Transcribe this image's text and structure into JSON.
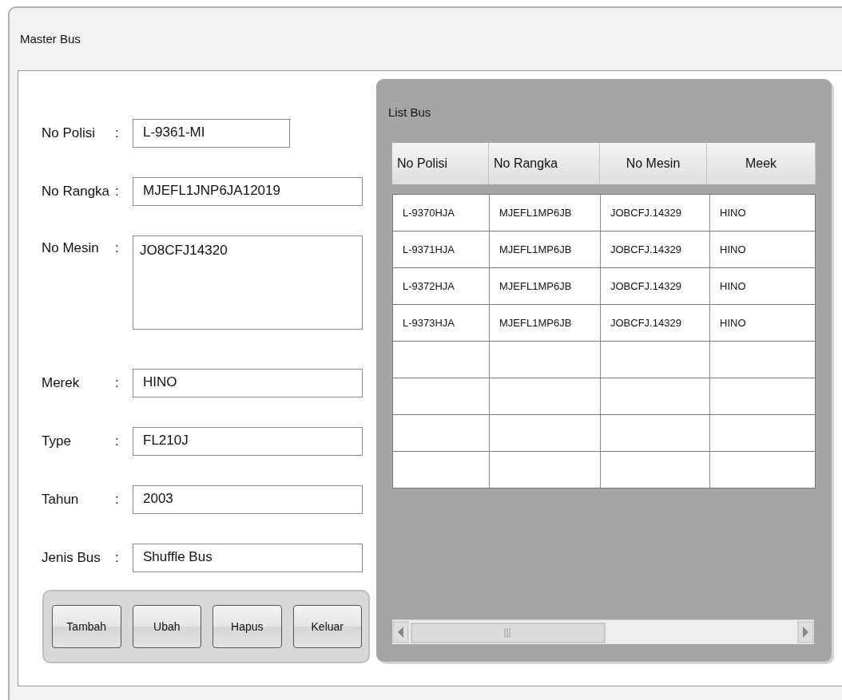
{
  "window": {
    "title": "Master Bus"
  },
  "form": {
    "fields": [
      {
        "label": "No Polisi",
        "separator": ":",
        "value": "L-9361-MI",
        "kind": "short"
      },
      {
        "label": "No Rangka",
        "separator": ":",
        "value": "MJEFL1JNP6JA12019",
        "kind": "text"
      },
      {
        "label": "No Mesin",
        "separator": ":",
        "value": "JO8CFJ14320",
        "kind": "textarea"
      },
      {
        "label": "Merek",
        "separator": ":",
        "value": "HINO",
        "kind": "text"
      },
      {
        "label": "Type",
        "separator": ":",
        "value": "FL210J",
        "kind": "text"
      },
      {
        "label": "Tahun",
        "separator": ":",
        "value": "2003",
        "kind": "text"
      },
      {
        "label": "Jenis Bus",
        "separator": ":",
        "value": "Shuffle Bus",
        "kind": "text"
      }
    ],
    "buttons": [
      "Tambah",
      "Ubah",
      "Hapus",
      "Keluar"
    ]
  },
  "list": {
    "title": "List Bus",
    "table": {
      "columns": [
        {
          "label": "No Polisi",
          "centered": false
        },
        {
          "label": "No Rangka",
          "centered": false
        },
        {
          "label": "No Mesin",
          "centered": true
        },
        {
          "label": "Meek",
          "centered": true
        }
      ],
      "rows": [
        [
          "L-9370HJA",
          "MJEFL1MP6JB",
          "JOBCFJ.14329",
          "HINO"
        ],
        [
          "L-9371HJA",
          "MJEFL1MP6JB",
          "JOBCFJ.14329",
          "HINO"
        ],
        [
          "L-9372HJA",
          "MJEFL1MP6JB",
          "JOBCFJ.14329",
          "HINO"
        ],
        [
          "L-9373HJA",
          "MJEFL1MP6JB",
          "JOBCFJ.14329",
          "HINO"
        ]
      ]
    }
  }
}
